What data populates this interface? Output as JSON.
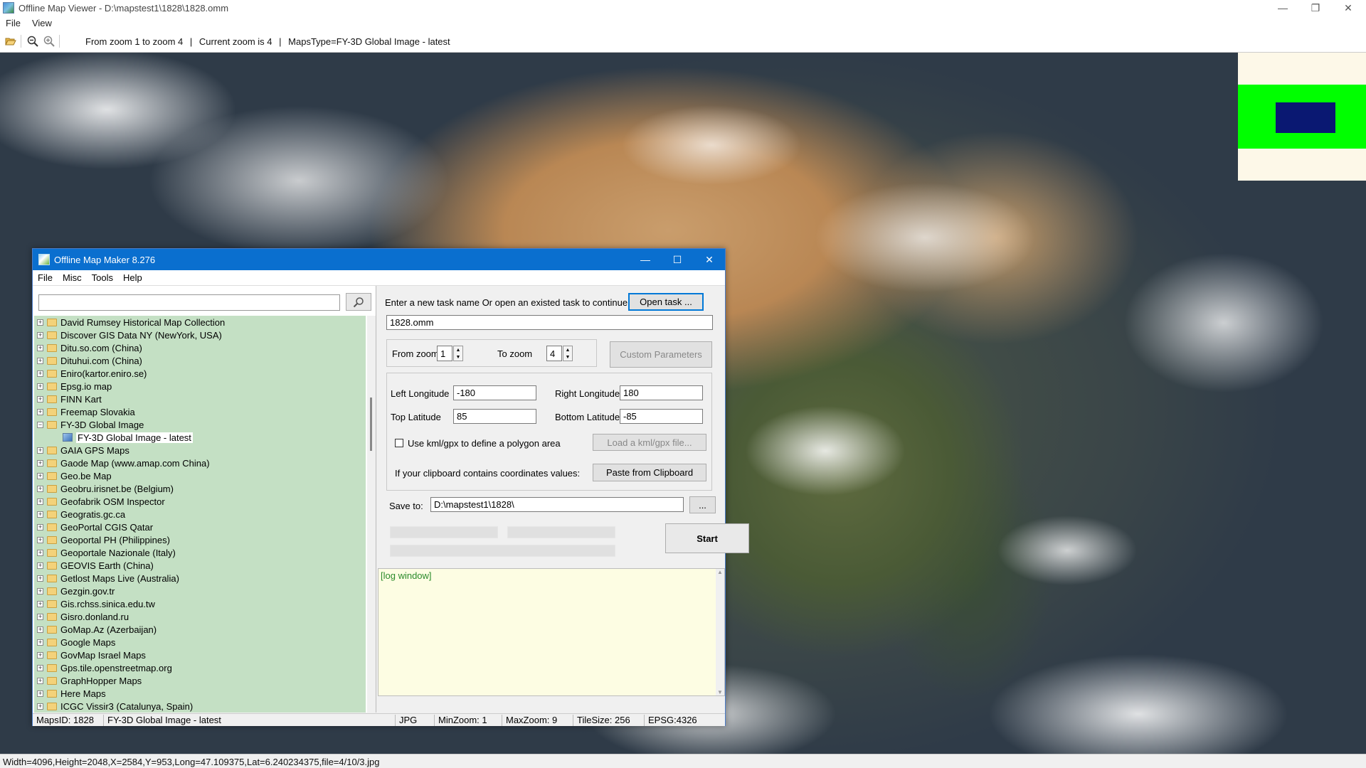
{
  "window": {
    "title": "Offline Map Viewer - D:\\mapstest1\\1828\\1828.omm"
  },
  "menu": {
    "file": "File",
    "view": "View"
  },
  "toolbar": {
    "open_icon": "folder-open-icon",
    "zoom_out_icon": "zoom-out-icon",
    "zoom_in_icon": "zoom-in-icon",
    "zoom_range": "From zoom 1 to zoom 4",
    "sep1": "|",
    "current_zoom": "Current zoom is 4",
    "sep2": "|",
    "maps_type": "MapsType=FY-3D Global Image - latest"
  },
  "status_bar": {
    "text": "Width=4096,Height=2048,X=2584,Y=953,Long=47.109375,Lat=6.240234375,file=4/10/3.jpg"
  },
  "dialog": {
    "title": "Offline Map Maker 8.276",
    "menu": [
      "File",
      "Misc",
      "Tools",
      "Help"
    ],
    "search": {
      "value": "",
      "icon": "search-icon"
    },
    "tree": [
      {
        "label": "David Rumsey Historical Map Collection"
      },
      {
        "label": "Discover GIS Data NY (NewYork, USA)"
      },
      {
        "label": "Ditu.so.com (China)"
      },
      {
        "label": "Dituhui.com (China)"
      },
      {
        "label": "Eniro(kartor.eniro.se)"
      },
      {
        "label": "Epsg.io map"
      },
      {
        "label": "FINN Kart"
      },
      {
        "label": "Freemap Slovakia"
      },
      {
        "label": "FY-3D Global Image",
        "expanded": true
      },
      {
        "label": "FY-3D Global Image - latest",
        "child": true
      },
      {
        "label": "GAIA GPS Maps"
      },
      {
        "label": "Gaode Map (www.amap.com China)"
      },
      {
        "label": "Geo.be Map"
      },
      {
        "label": "Geobru.irisnet.be (Belgium)"
      },
      {
        "label": "Geofabrik OSM Inspector"
      },
      {
        "label": "Geogratis.gc.ca"
      },
      {
        "label": "GeoPortal CGIS Qatar"
      },
      {
        "label": "Geoportal PH (Philippines)"
      },
      {
        "label": "Geoportale Nazionale (Italy)"
      },
      {
        "label": "GEOVIS Earth (China)"
      },
      {
        "label": "Getlost Maps Live (Australia)"
      },
      {
        "label": "Gezgin.gov.tr"
      },
      {
        "label": "Gis.rchss.sinica.edu.tw"
      },
      {
        "label": "Gisro.donland.ru"
      },
      {
        "label": "GoMap.Az (Azerbaijan)"
      },
      {
        "label": "Google Maps"
      },
      {
        "label": "GovMap Israel Maps"
      },
      {
        "label": "Gps.tile.openstreetmap.org"
      },
      {
        "label": "GraphHopper Maps"
      },
      {
        "label": "Here Maps"
      },
      {
        "label": "ICGC Vissir3 (Catalunya, Spain)"
      }
    ],
    "task_prompt": "Enter a new task name Or open an existed task to continue:",
    "open_task": "Open task ...",
    "task_name": "1828.omm",
    "from_zoom_label": "From zoom",
    "from_zoom": "1",
    "to_zoom_label": "To zoom",
    "to_zoom": "4",
    "custom_params": "Custom Parameters",
    "left_lon_label": "Left Longitude",
    "left_lon": "-180",
    "right_lon_label": "Right Longitude",
    "right_lon": "180",
    "top_lat_label": "Top Latitude",
    "top_lat": "85",
    "bottom_lat_label": "Bottom Latitude",
    "bottom_lat": "-85",
    "kml_check": "Use kml/gpx to define a polygon area",
    "load_kml": "Load a kml/gpx file...",
    "clipboard_label": "If your clipboard contains coordinates values:",
    "paste_btn": "Paste from Clipboard",
    "save_to_label": "Save to:",
    "save_to": "D:\\mapstest1\\1828\\",
    "browse_btn": "...",
    "start_btn": "Start",
    "log_text": "[log window]",
    "status": {
      "maps_id": "MapsID: 1828",
      "map_name": "FY-3D Global Image - latest",
      "format": "JPG",
      "min_zoom": "MinZoom: 1",
      "max_zoom": "MaxZoom: 9",
      "tile_size": "TileSize: 256",
      "epsg": "EPSG:4326"
    }
  }
}
